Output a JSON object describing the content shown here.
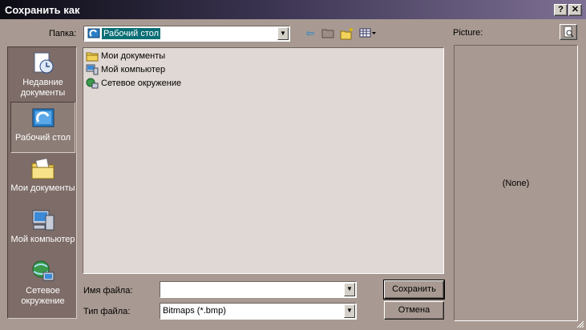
{
  "window": {
    "title": "Сохранить как",
    "help_button": "?",
    "close_button": "✕"
  },
  "toolbar": {
    "folder_label": "Папка:",
    "folder_value": "Рабочий стол",
    "icons": [
      "back-arrow-icon",
      "up-folder-icon",
      "new-folder-icon",
      "view-menu-icon"
    ]
  },
  "places": [
    {
      "label": "Недавние документы",
      "icon": "recent-documents-icon",
      "active": false
    },
    {
      "label": "Рабочий стол",
      "icon": "desktop-icon",
      "active": true
    },
    {
      "label": "Мои документы",
      "icon": "my-documents-icon",
      "active": false
    },
    {
      "label": "Мой компьютер",
      "icon": "my-computer-icon",
      "active": false
    },
    {
      "label": "Сетевое окружение",
      "icon": "network-icon",
      "active": false
    }
  ],
  "files": [
    {
      "name": "Мои документы",
      "icon": "folder-icon"
    },
    {
      "name": "Мой компьютер",
      "icon": "computer-icon"
    },
    {
      "name": "Сетевое окружение",
      "icon": "network-icon"
    }
  ],
  "form": {
    "filename_label": "Имя файла:",
    "filename_value": "",
    "filetype_label": "Тип файла:",
    "filetype_value": "Bitmaps (*.bmp)"
  },
  "buttons": {
    "save": "Сохранить",
    "cancel": "Отмена"
  },
  "preview": {
    "label": "Picture:",
    "value": "(None)"
  },
  "colors": {
    "dialog_bg": "#a89a92",
    "places_bg": "#7d6c67",
    "list_bg": "#e0d8d4",
    "selection": "#0a6e75"
  }
}
